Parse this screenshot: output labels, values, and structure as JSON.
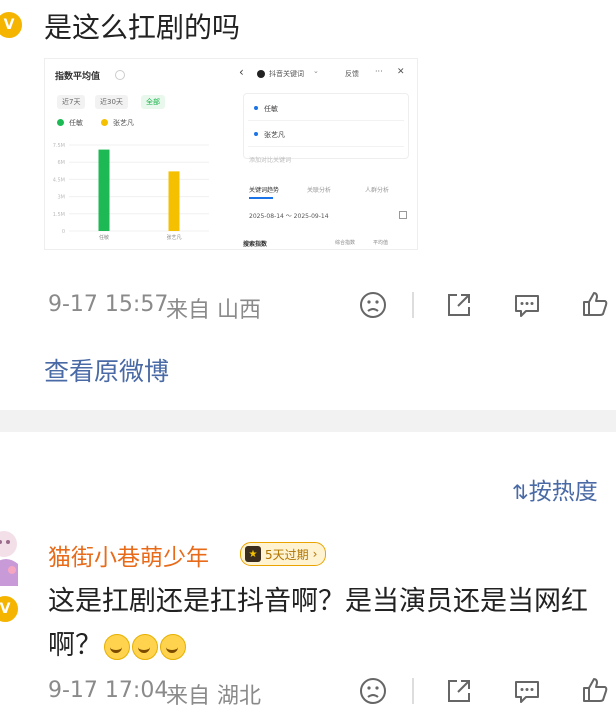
{
  "post": {
    "text": "是这么扛剧的吗",
    "verified_badge": "V",
    "screenshot": {
      "left": {
        "title": "指数平均值",
        "ranges": [
          "近7天",
          "近30天",
          "全部"
        ],
        "active_range": "全部",
        "legend": [
          {
            "name": "任敏",
            "color": "#1db954"
          },
          {
            "name": "张艺凡",
            "color": "#f5c000"
          }
        ],
        "y_ticks": [
          "7.5M",
          "6M",
          "4.5M",
          "3M",
          "1.5M",
          "0"
        ],
        "chart_data": {
          "type": "bar",
          "categories": [
            "任敏",
            "张艺凡"
          ],
          "values": [
            7.1,
            5.2
          ],
          "ylim": [
            0,
            7.5
          ],
          "colors": [
            "#1db954",
            "#f5c000"
          ]
        }
      },
      "right": {
        "back": "‹",
        "title": "抖音关键词",
        "dropdown_caret": "⌄",
        "feedback": "反馈",
        "more": "···",
        "close": "✕",
        "items": [
          "任敏",
          "张艺凡"
        ],
        "add_placeholder": "添加对比关键词",
        "tabs": [
          "关键词趋势",
          "关联分析",
          "人群分析"
        ],
        "date_range": "2025-08-14 ～ 2025-09-14",
        "footer_left": "搜索指数",
        "footer_right": [
          "综合指数",
          "平均值"
        ]
      }
    },
    "meta": {
      "time": "9-17 15:57",
      "from": "来自 山西"
    }
  },
  "view_original": "查看原微博",
  "sort": {
    "label": "按热度"
  },
  "comment": {
    "username": "猫街小巷萌少年",
    "badge_text": "5天过期",
    "text": "这是扛剧还是扛抖音啊？是当演员还是当网红啊？",
    "meta": {
      "time": "9-17 17:04",
      "from": "来自 湖北"
    }
  },
  "icons": [
    "sad-face-icon",
    "share-icon",
    "comment-icon",
    "like-icon"
  ]
}
